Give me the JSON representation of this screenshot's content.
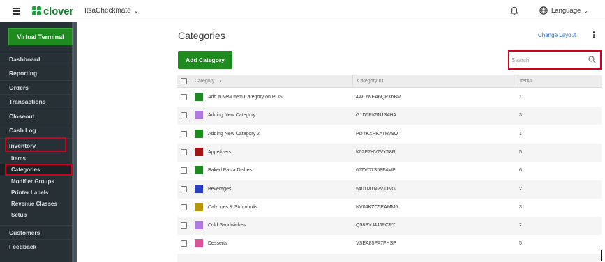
{
  "topbar": {
    "logo_text": "clover",
    "merchant_name": "ItsaCheckmate",
    "merchant_chevron": "⌄",
    "language_label": "Language",
    "language_chevron": "⌄"
  },
  "sidebar": {
    "virtual_terminal": "Virtual Terminal",
    "items": [
      {
        "label": "Dashboard"
      },
      {
        "label": "Reporting"
      },
      {
        "label": "Orders"
      },
      {
        "label": "Transactions"
      },
      {
        "label": "Closeout"
      },
      {
        "label": "Cash Log"
      },
      {
        "label": "Inventory"
      }
    ],
    "sub_items": [
      {
        "label": "Items"
      },
      {
        "label": "Categories"
      },
      {
        "label": "Modifier Groups"
      },
      {
        "label": "Printer Labels"
      },
      {
        "label": "Revenue Classes"
      },
      {
        "label": "Setup"
      }
    ],
    "bottom_items": [
      {
        "label": "Customers"
      },
      {
        "label": "Feedback"
      }
    ]
  },
  "main": {
    "title": "Categories",
    "change_layout": "Change Layout",
    "add_button": "Add Category",
    "search_placeholder": "Search"
  },
  "table": {
    "columns": [
      "Category",
      "Category ID",
      "Items"
    ],
    "sort_indicator": "▲",
    "rows": [
      {
        "name": "Add a New Item Category on POS",
        "id": "4WOWEA6QPX6BM",
        "items": "1",
        "color": "#1f8a1f"
      },
      {
        "name": "Adding New Category",
        "id": "G1D5PK5N134HA",
        "items": "3",
        "color": "#b07be0"
      },
      {
        "name": "Adding New Category 2",
        "id": "PDYKXHKATR79O",
        "items": "1",
        "color": "#1f8a1f"
      },
      {
        "name": "Appetizers",
        "id": "K02P7HV7VY18R",
        "items": "5",
        "color": "#a31515"
      },
      {
        "name": "Baked Pasta Dishes",
        "id": "66ZVD7S58F4MP",
        "items": "6",
        "color": "#1f8a1f"
      },
      {
        "name": "Beverages",
        "id": "5401MTN2VJJNG",
        "items": "2",
        "color": "#2a3fc8"
      },
      {
        "name": "Calzones & Strombolis",
        "id": "NV04KZC5EAMM6",
        "items": "3",
        "color": "#b8960c"
      },
      {
        "name": "Cold Sandwiches",
        "id": "Q58SYJ4JJRCRY",
        "items": "2",
        "color": "#b07be0"
      },
      {
        "name": "Desserts",
        "id": "VSEA85PA7FHSP",
        "items": "5",
        "color": "#d9559a"
      }
    ]
  },
  "colors": {
    "brand_green": "#1f8a1f",
    "sidebar_bg": "#263035",
    "highlight_red": "#d0021b",
    "link_blue": "#2a6eb8"
  }
}
